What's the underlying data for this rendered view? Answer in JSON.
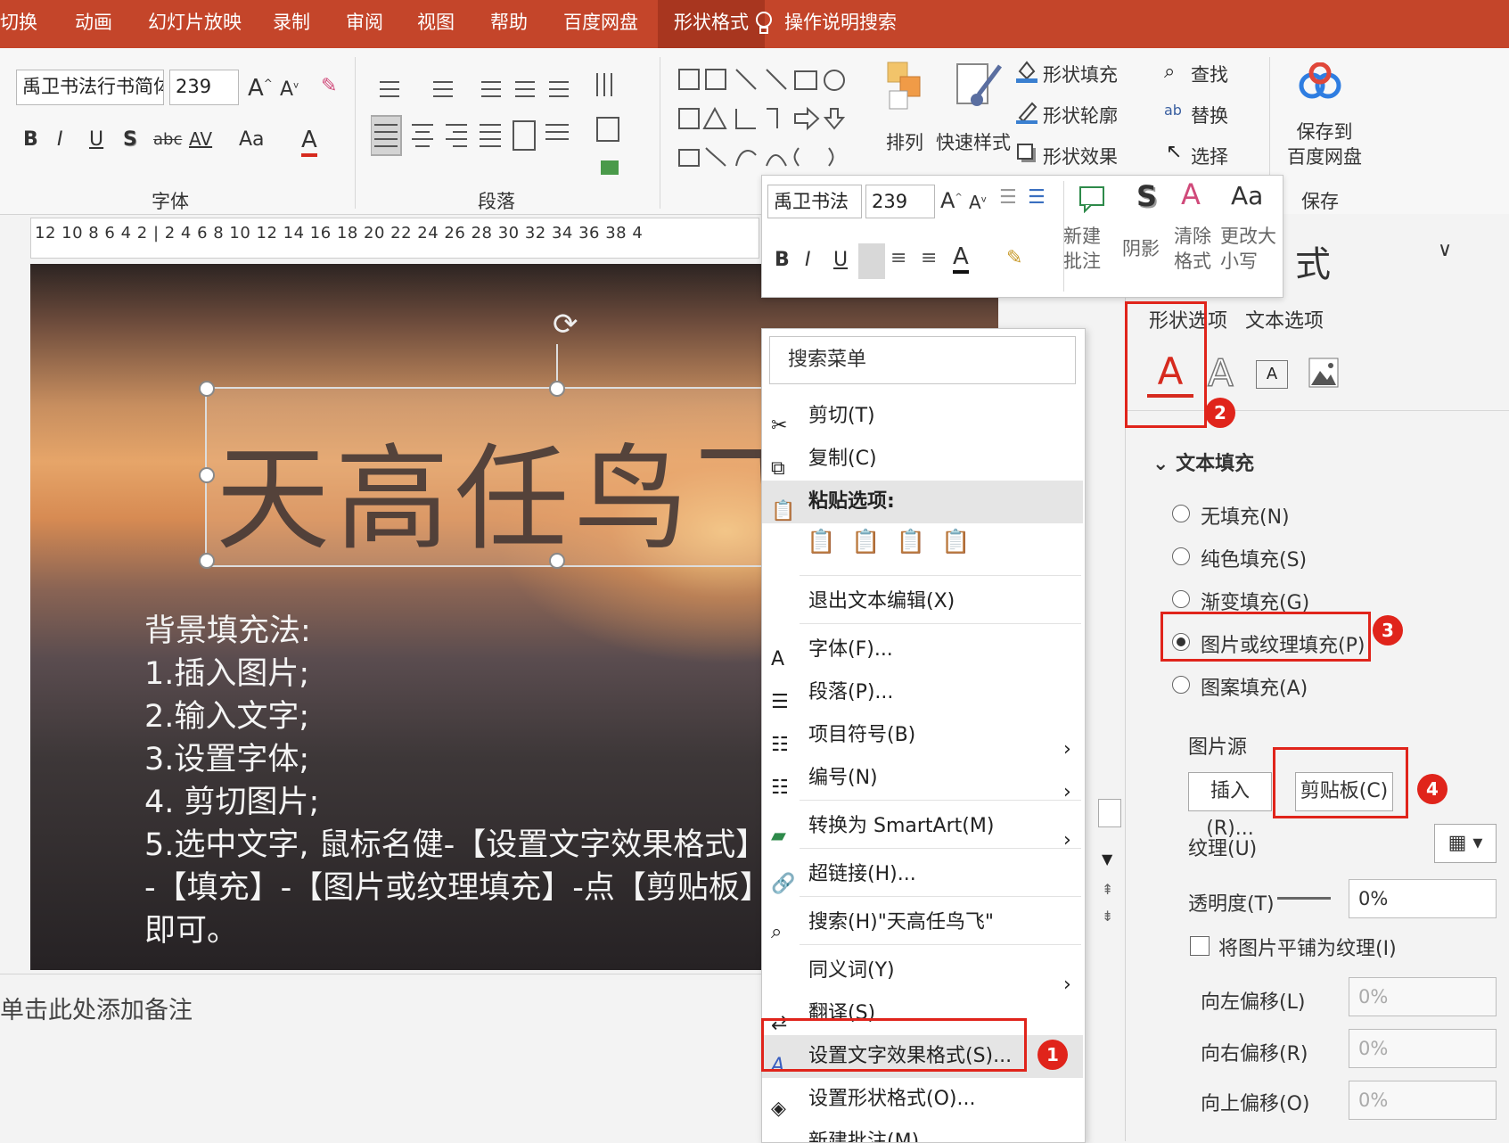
{
  "ribbon_tabs": [
    "切换",
    "动画",
    "幻灯片放映",
    "录制",
    "审阅",
    "视图",
    "帮助",
    "百度网盘",
    "形状格式"
  ],
  "tell_me": "操作说明搜索",
  "font_group": {
    "font_name": "禹卫书法行书简体",
    "font_size": "239",
    "bold": "B",
    "italic": "I",
    "underline": "U",
    "shadow": "S",
    "strike": "abc",
    "spacing": "AV",
    "case": "Aa",
    "color": "A",
    "label": "字体"
  },
  "paragraph_group": {
    "label": "段落"
  },
  "shape_group": {
    "arrange": "排列",
    "quick_styles": "快速样式",
    "fill": "形状填充",
    "outline": "形状轮廓",
    "effects": "形状效果"
  },
  "edit_group": {
    "find": "查找",
    "replace": "替换",
    "select": "选择"
  },
  "save_group": {
    "save_btn": "保存到\n百度网盘",
    "label": "保存"
  },
  "ruler": "12 10 8 6 4 2 | 2 4 6 8 10 12 14 16 18 20 22 24 26 28 30 32 34 36 38 4",
  "slide": {
    "title_text": "天高任鸟飞",
    "steps": [
      "背景填充法:",
      "1.插入图片;",
      "2.输入文字;",
      "3.设置字体;",
      "4. 剪切图片;",
      "5.选中文字, 鼠标名健-【设置文字效果格式】",
      "-【填充】-【图片或纹理填充】-点【剪贴板】",
      "即可。"
    ]
  },
  "notes_placeholder": "单击此处添加备注",
  "mini_toolbar": {
    "font_name": "禹卫书法",
    "font_size": "239",
    "new_comment": "新建\n批注",
    "shadow": "阴影",
    "clear_format": "清除\n格式",
    "change_case": "更改大\n小写",
    "shadow_icon": "S",
    "case_icon": "Aa"
  },
  "context_menu": {
    "search": "搜索菜单",
    "items": [
      "剪切(T)",
      "复制(C)",
      "粘贴选项:",
      "退出文本编辑(X)",
      "字体(F)...",
      "段落(P)...",
      "项目符号(B)",
      "编号(N)",
      "转换为 SmartArt(M)",
      "超链接(H)...",
      "搜索(H)\"天高任鸟飞\"",
      "同义词(Y)",
      "翻译(S)",
      "设置文字效果格式(S)...",
      "设置形状格式(O)...",
      "新建批注(M)"
    ]
  },
  "format_pane": {
    "title": "设置形状格式",
    "title_fragment": "式",
    "tabs": [
      "形状选项",
      "文本选项"
    ],
    "section": "文本填充",
    "options": [
      "无填充(N)",
      "纯色填充(S)",
      "渐变填充(G)",
      "图片或纹理填充(P)",
      "图案填充(A)"
    ],
    "selected_option": "图片或纹理填充(P)",
    "picture_source": "图片源",
    "insert_btn": "插入(R)...",
    "clipboard_btn": "剪贴板(C)",
    "texture": "纹理(U)",
    "transparency": "透明度(T)",
    "transparency_value": "0%",
    "tile": "将图片平铺为纹理(I)",
    "offset_left": "向左偏移(L)",
    "offset_right": "向右偏移(R)",
    "offset_top": "向上偏移(O)",
    "offset_value": "0%"
  },
  "annotations": [
    "1",
    "2",
    "3",
    "4"
  ],
  "colors": {
    "ribbon": "#c4452a",
    "ribbon_active": "#a8361f",
    "highlight": "#e0241b"
  }
}
